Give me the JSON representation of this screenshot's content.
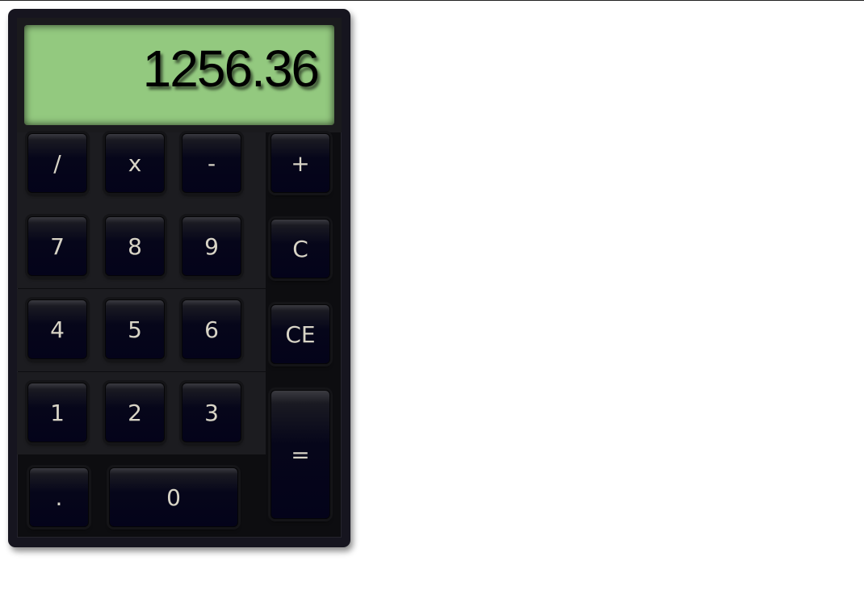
{
  "display": {
    "value": "1256.36"
  },
  "keys": {
    "divide": "/",
    "multiply": "x",
    "subtract": "-",
    "add": "+",
    "seven": "7",
    "eight": "8",
    "nine": "9",
    "clear": "C",
    "four": "4",
    "five": "5",
    "six": "6",
    "clear_entry": "CE",
    "one": "1",
    "two": "2",
    "three": "3",
    "equals": "=",
    "decimal": ".",
    "zero": "0"
  },
  "colors": {
    "display_background": "#93c97f",
    "display_text": "#000000",
    "body": "#16151f",
    "key_face": "#04031a",
    "key_label": "#d8d4c6"
  }
}
